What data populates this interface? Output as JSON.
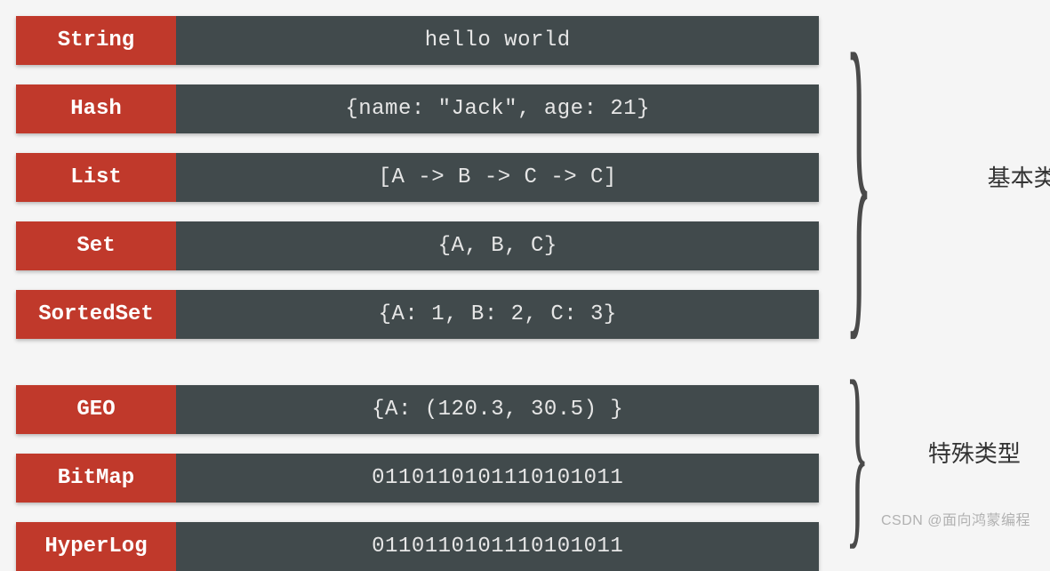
{
  "groups": [
    {
      "label": "基本类型",
      "rows": [
        0,
        1,
        2,
        3,
        4
      ]
    },
    {
      "label": "特殊类型",
      "rows": [
        5,
        6,
        7
      ]
    }
  ],
  "rows": [
    {
      "type": "String",
      "value": "hello world"
    },
    {
      "type": "Hash",
      "value": "{name: \"Jack\", age: 21}"
    },
    {
      "type": "List",
      "value": "[A -> B -> C -> C]"
    },
    {
      "type": "Set",
      "value": "{A, B, C}"
    },
    {
      "type": "SortedSet",
      "value": "{A: 1, B: 2, C: 3}"
    },
    {
      "type": "GEO",
      "value": "{A: (120.3,  30.5) }"
    },
    {
      "type": "BitMap",
      "value": "0110110101110101011"
    },
    {
      "type": "HyperLog",
      "value": "0110110101110101011"
    }
  ],
  "watermark": "CSDN @面向鸿蒙编程",
  "colors": {
    "type_bg": "#c0392b",
    "value_bg": "#414a4c",
    "page_bg": "#f5f5f5"
  }
}
